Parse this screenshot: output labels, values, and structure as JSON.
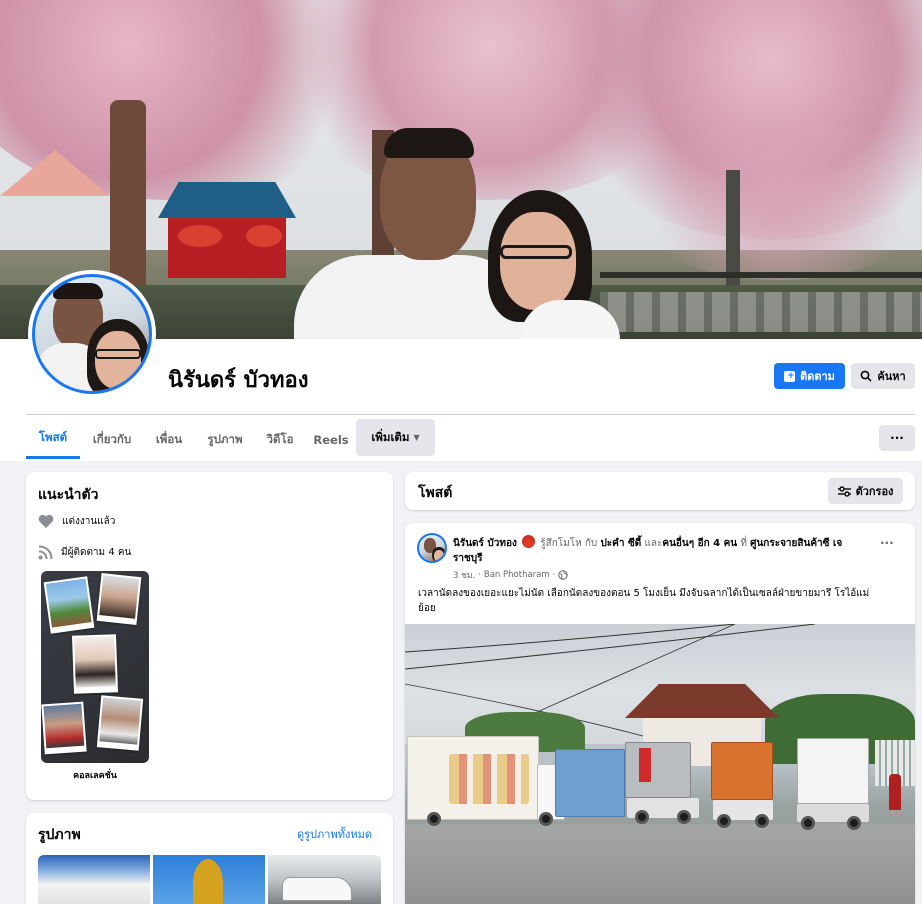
{
  "profile": {
    "name": "นิรันดร์ บัวทอง"
  },
  "actions": {
    "follow_label": "ติดตาม",
    "search_label": "ค้นหา",
    "more_options": "···"
  },
  "tabs": [
    {
      "label": "โพสต์"
    },
    {
      "label": "เกี่ยวกับ"
    },
    {
      "label": "เพื่อน"
    },
    {
      "label": "รูปภาพ"
    },
    {
      "label": "วิดีโอ"
    },
    {
      "label": "Reels"
    },
    {
      "label": "เพิ่มเติม"
    }
  ],
  "intro": {
    "title": "แนะนำตัว",
    "relationship": "แต่งงานแล้ว",
    "followers": "มีผู้ติดตาม 4 คน",
    "collection_label": "คอลเลคชั่น"
  },
  "photos": {
    "title": "รูปภาพ",
    "see_all": "ดูรูปภาพทั้งหมด"
  },
  "posts_header": {
    "title": "โพสต์",
    "filter_label": "ตัวกรอง"
  },
  "post": {
    "author": "นิรันดร์ บัวทอง",
    "feeling": "รู้สึกโมโห กับ",
    "tagged": "ปะคำ ซีดี้",
    "and_label": "และ",
    "others": "คนอื่นๆ อีก 4 คน",
    "at_label": "ที่",
    "place": "ศูนกระจายสินค้าซี เจราชบุรี",
    "time": "3 ชม.",
    "location": "Ban Photharam",
    "text": "เวลานัดลงของเยอะแยะไม่นัด เลือกนัดลงของตอน 5 โมงเย็น มึงจับฉลากได้เป็นเซลล์ฝ่ายขายมารึ โรไอ้แม่ย้อย",
    "more_options": "···"
  },
  "colors": {
    "accent": "#1877f2",
    "background": "#f0f2f5",
    "secondary_text": "#65676b"
  }
}
